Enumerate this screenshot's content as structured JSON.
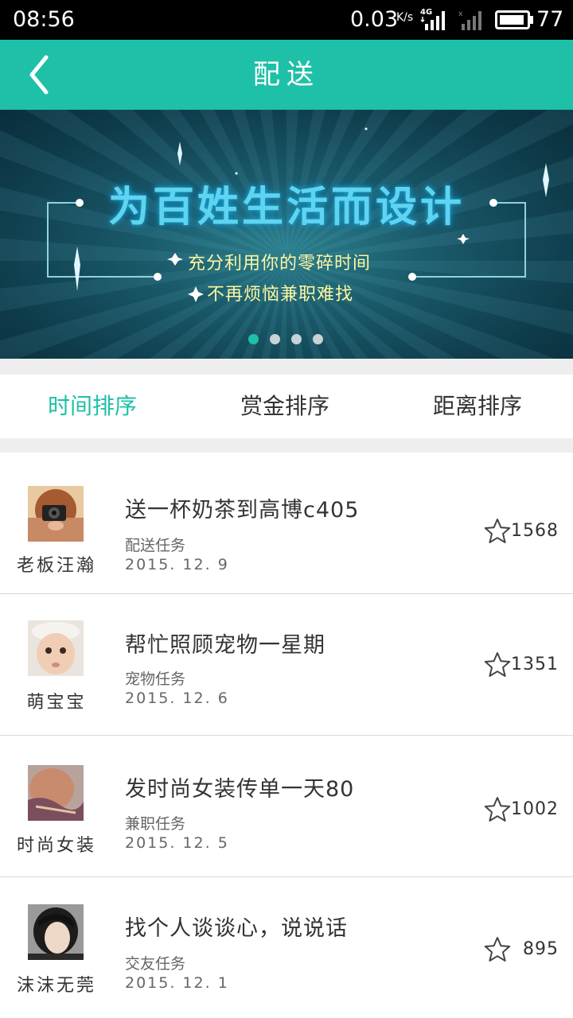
{
  "status_bar": {
    "time": "08:56",
    "speed": "0.03",
    "speed_unit": "K/s",
    "network": "4G",
    "battery": "77"
  },
  "nav": {
    "title": "配送"
  },
  "banner": {
    "title": "为百姓生活而设计",
    "line1": "充分利用你的零碎时间",
    "line2": "不再烦恼兼职难找",
    "dots": 4,
    "active_dot": 0
  },
  "sort_tabs": [
    {
      "label": "时间排序",
      "active": true
    },
    {
      "label": "赏金排序",
      "active": false
    },
    {
      "label": "距离排序",
      "active": false
    }
  ],
  "tasks": [
    {
      "user": "老板汪瀚",
      "title": "送一杯奶茶到高博c405",
      "type": "配送任务",
      "date": "2015. 12. 9",
      "reward": "1568",
      "avatar_icon": "girl-with-camera-avatar"
    },
    {
      "user": "萌宝宝",
      "title": "帮忙照顾宠物一星期",
      "type": "宠物任务",
      "date": "2015. 12. 6",
      "reward": "1351",
      "avatar_icon": "baby-avatar"
    },
    {
      "user": "时尚女装",
      "title": "发时尚女装传单一天80",
      "type": "兼职任务",
      "date": "2015. 12. 5",
      "reward": "1002",
      "avatar_icon": "fashion-girl-avatar"
    },
    {
      "user": "沫沫无莞",
      "title": "找个人谈谈心，说说话",
      "type": "交友任务",
      "date": "2015. 12. 1",
      "reward": "895",
      "avatar_icon": "girl-portrait-avatar"
    }
  ],
  "colors": {
    "accent": "#1ec0a8",
    "status_bar": "#000000"
  }
}
